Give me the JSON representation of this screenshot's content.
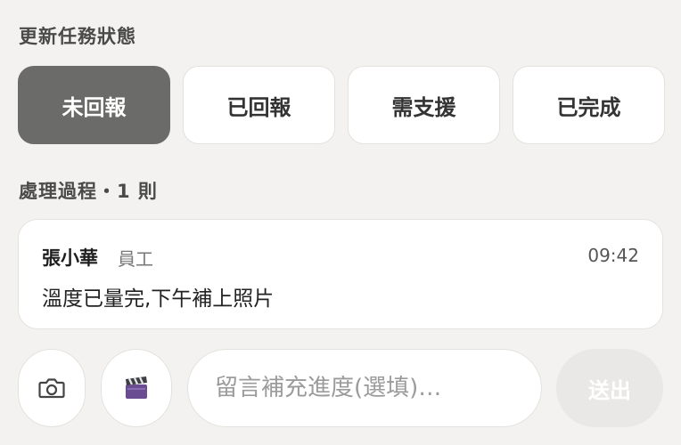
{
  "status_section": {
    "title": "更新任務狀態",
    "options": [
      {
        "label": "未回報",
        "active": true
      },
      {
        "label": "已回報",
        "active": false
      },
      {
        "label": "需支援",
        "active": false
      },
      {
        "label": "已完成",
        "active": false
      }
    ]
  },
  "log_section": {
    "title": "處理過程・1 則",
    "entries": [
      {
        "author": "張小華",
        "role": "員工",
        "time": "09:42",
        "message": "溫度已量完,下午補上照片"
      }
    ]
  },
  "composer": {
    "camera_icon": "camera-icon",
    "video_icon": "clapperboard-icon",
    "placeholder": "留言補充進度(選填)…",
    "value": "",
    "send_label": "送出"
  },
  "colors": {
    "active_status_bg": "#6b6b69",
    "page_bg": "#f3f2f0",
    "send_disabled_bg": "#e9e8e6"
  }
}
